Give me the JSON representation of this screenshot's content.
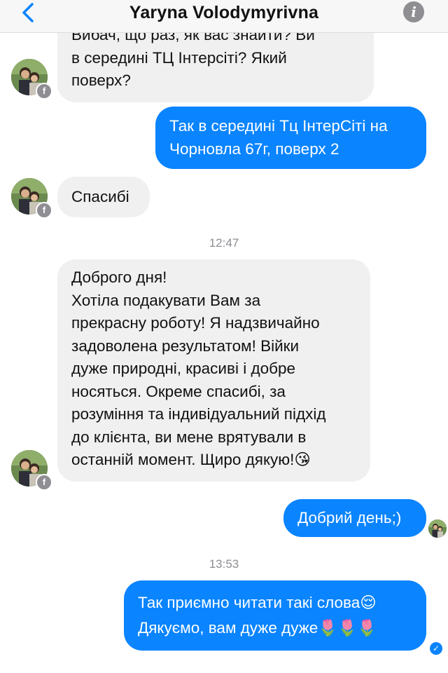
{
  "header": {
    "title": "Yaryna Volodymyrivna",
    "back_icon": "chevron-left-icon",
    "info_icon": "info-icon",
    "info_glyph": "i"
  },
  "colors": {
    "outgoing_bubble": "#0a84ff",
    "incoming_bubble": "#f1f0f0",
    "timestamp": "#8e8e93"
  },
  "messages": [
    {
      "sender": "contact",
      "text": "Вибач, що раз, як вас знайти? Ви\nв середині ТЦ Інтерсіті? Який\nповерх?"
    },
    {
      "sender": "me",
      "text": "Так в середині Тц ІнтерСіті на\nЧорновла 67г, поверх 2"
    },
    {
      "sender": "contact",
      "text": "Спасибі"
    },
    {
      "timestamp": "12:47"
    },
    {
      "sender": "contact",
      "text": "Доброго дня!\nХотіла подакувати Вам за\nпрекрасну роботу! Я надзвичайно\nзадоволена результатом! Війки\nдуже природні, красиві і добре\nносяться. Окреме спасибі, за\nрозуміння та індивідуальний підхід\nдо клієнта, ви мене врятували в\nостанній момент. Щиро дякую!😘"
    },
    {
      "sender": "me",
      "text": "Добрий день;)"
    },
    {
      "timestamp": "13:53"
    },
    {
      "sender": "me",
      "text": "Так приємно читати такі слова😌\nДякуємо, вам дуже дуже🌷🌷🌷"
    }
  ],
  "badges": {
    "facebook_glyph": "f",
    "delivered_glyph": "✓"
  }
}
